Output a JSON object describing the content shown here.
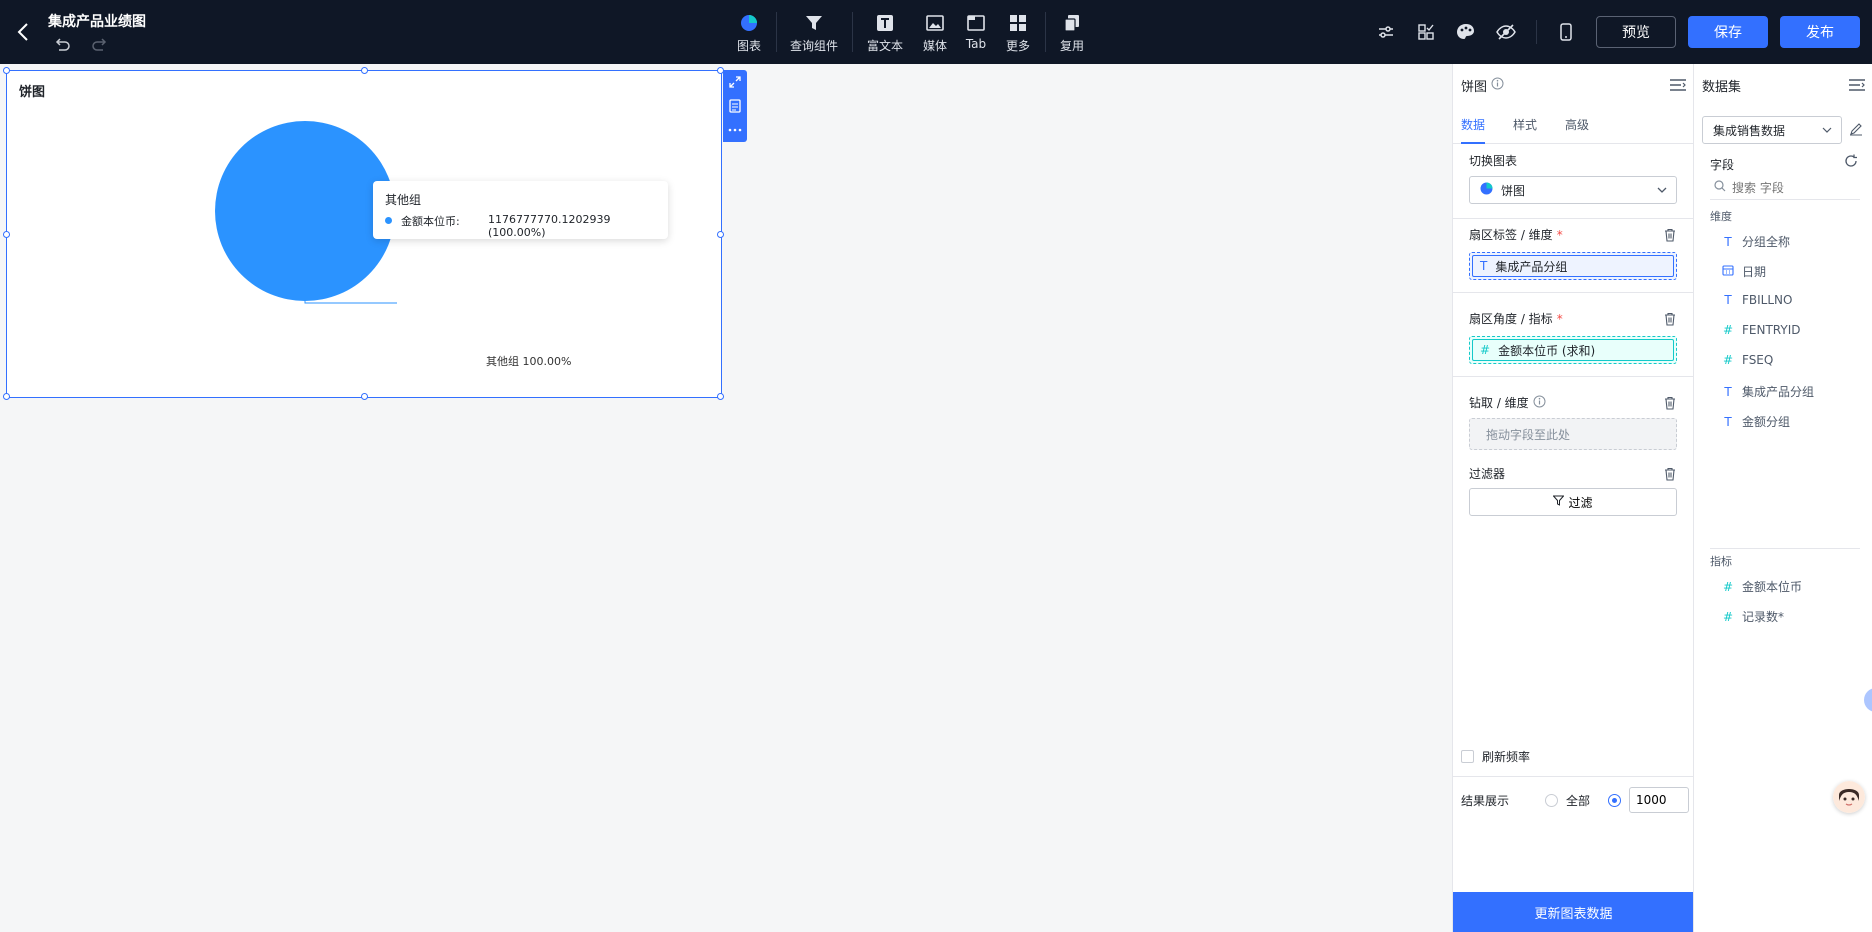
{
  "header": {
    "title": "集成产品业绩图",
    "tools": [
      {
        "label": "图表",
        "icon": "pie-chart-icon"
      },
      {
        "label": "查询组件",
        "icon": "filter-funnel-icon"
      },
      {
        "label": "富文本",
        "icon": "rich-text-icon"
      },
      {
        "label": "媒体",
        "icon": "image-icon"
      },
      {
        "label": "Tab",
        "icon": "tab-icon"
      },
      {
        "label": "更多",
        "icon": "grid-icon"
      },
      {
        "label": "复用",
        "icon": "copy-icon"
      }
    ],
    "right_icons": [
      "sliders-icon",
      "checklist-icon",
      "palette-icon",
      "eye-off-icon",
      "mobile-icon"
    ],
    "preview_label": "预览",
    "save_label": "保存",
    "publish_label": "发布"
  },
  "chart_card": {
    "title": "饼图",
    "chart_data": {
      "type": "pie",
      "slices": [
        {
          "name": "其他组",
          "value": 1176777770.1202939,
          "percent": 100.0,
          "color": "#2b93ff"
        }
      ],
      "slice_label": "其他组 100.00%",
      "tooltip": {
        "title": "其他组",
        "series_name": "金额本位币:",
        "value_text": "1176777770.1202939 (100.00%)"
      }
    }
  },
  "config": {
    "title": "饼图",
    "tabs": [
      "数据",
      "样式",
      "高级"
    ],
    "active_tab": "数据",
    "switch_chart_label": "切换图表",
    "chart_type_value": "饼图",
    "sector_label_title": "扇区标签 / 维度",
    "sector_label_field": "集成产品分组",
    "sector_angle_title": "扇区角度 / 指标",
    "sector_angle_field": "金额本位币 (求和)",
    "drill_title": "钻取 / 维度",
    "drill_placeholder": "拖动字段至此处",
    "filter_title": "过滤器",
    "filter_button": "过滤",
    "refresh_label": "刷新频率",
    "result_label": "结果展示",
    "result_all": "全部",
    "result_count": "1000",
    "update_button": "更新图表数据"
  },
  "dataset": {
    "title": "数据集",
    "selected": "集成销售数据",
    "fields_label": "字段",
    "search_placeholder": "搜索 字段",
    "dimension_group": "维度",
    "dimensions": [
      {
        "type": "T",
        "name": "分组全称"
      },
      {
        "type": "date",
        "name": "日期"
      },
      {
        "type": "T",
        "name": "FBILLNO"
      },
      {
        "type": "#",
        "name": "FENTRYID"
      },
      {
        "type": "#",
        "name": "FSEQ"
      },
      {
        "type": "T",
        "name": "集成产品分组"
      },
      {
        "type": "T",
        "name": "金额分组"
      }
    ],
    "metric_group": "指标",
    "metrics": [
      {
        "type": "#",
        "name": "金额本位币"
      },
      {
        "type": "#",
        "name": "记录数*"
      }
    ]
  }
}
